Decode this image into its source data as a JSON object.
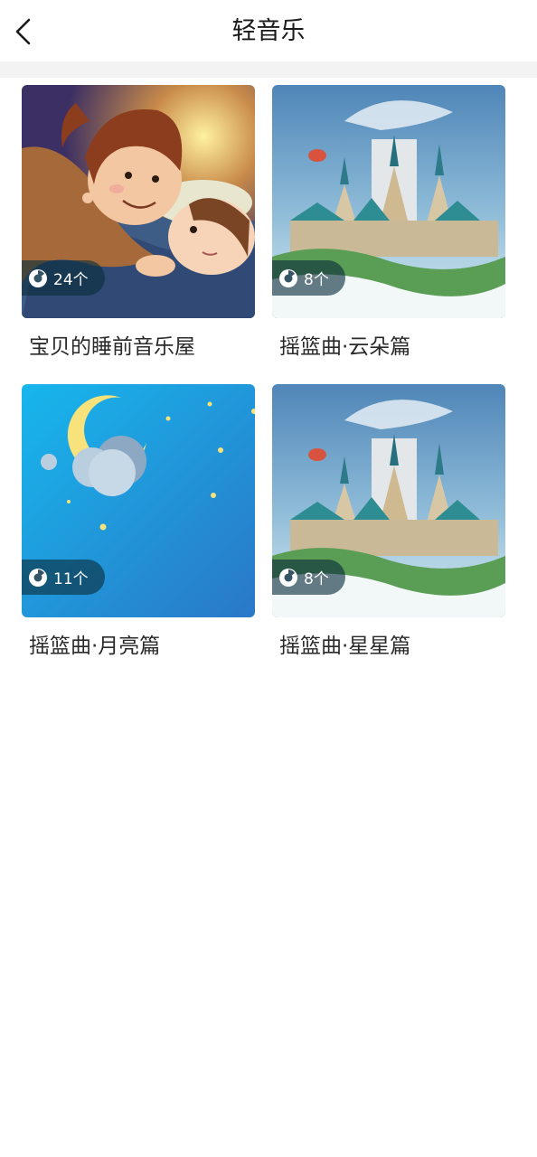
{
  "header": {
    "title": "轻音乐",
    "back_icon": "chevron-left-icon"
  },
  "albums": [
    {
      "name": "宝贝的睡前音乐屋",
      "count": "24个",
      "cover": "illustration of parent tucking a child into bed"
    },
    {
      "name": "摇篮曲·云朵篇",
      "count": "8个",
      "cover": "fantasy castle floating in clouds"
    },
    {
      "name": "摇篮曲·月亮篇",
      "count": "11个",
      "cover": "crescent moon with cloud and stars on blue sky"
    },
    {
      "name": "摇篮曲·星星篇",
      "count": "8个",
      "cover": "fantasy castle floating in clouds"
    }
  ],
  "colors": {
    "divider": "#f3f3f3",
    "badge_bg": "#0a2d3c",
    "moon_sky": "#1d8fd8",
    "moon": "#f7e27c"
  }
}
